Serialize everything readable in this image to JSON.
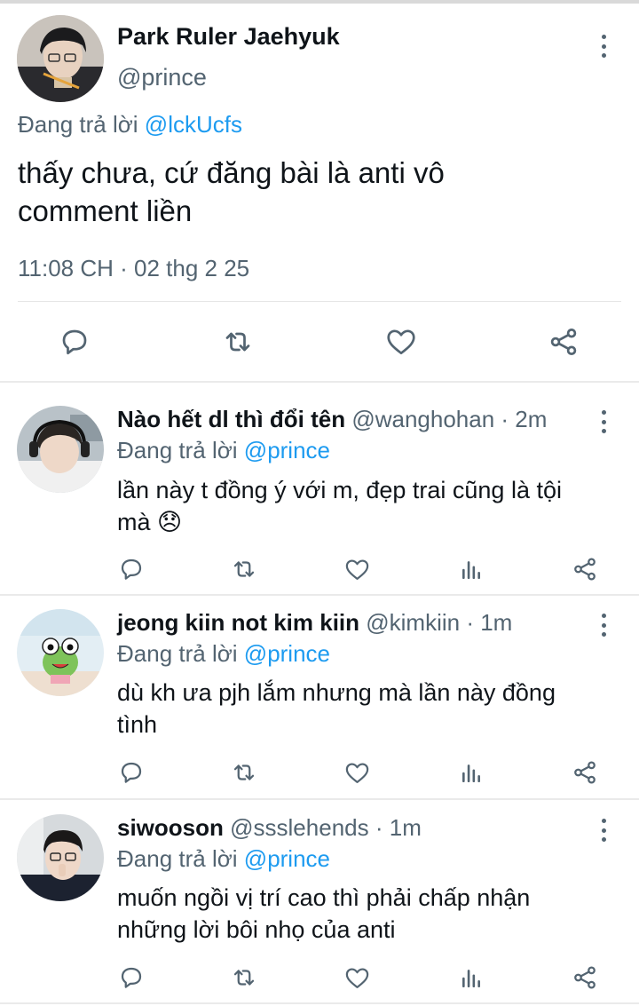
{
  "main_tweet": {
    "author_name": "Park Ruler Jaehyuk",
    "handle": "@prince",
    "reply_prefix": "Đang trả lời",
    "reply_to": "@lckUcfs",
    "text_line1": "thấy chưa, cứ đăng bài là anti vô",
    "text_line2": "comment liền",
    "timestamp": "11:08 CH · 02 thg 2 25"
  },
  "replies": [
    {
      "author_name": "Nào hết dl thì đổi tên",
      "handle": "@wanghohan",
      "time": "· 2m",
      "reply_prefix": "Đang trả lời",
      "reply_to": "@prince",
      "text_line1": "lần này t đồng ý với m, đẹp trai cũng là tội",
      "text_line2": "mà 😞"
    },
    {
      "author_name": "jeong kiin not kim kiin",
      "handle": "@kimkiin",
      "time": "· 1m",
      "reply_prefix": "Đang trả lời",
      "reply_to": "@prince",
      "text_line1": "dù kh ưa pjh lắm nhưng mà lần này đồng",
      "text_line2": "tình"
    },
    {
      "author_name": "siwooson",
      "handle": "@ssslehends",
      "time": "· 1m",
      "reply_prefix": "Đang trả lời",
      "reply_to": "@prince",
      "text_line1": "muốn ngồi vị trí cao thì phải chấp nhận",
      "text_line2": "những lời bôi nhọ của anti"
    }
  ],
  "icons": {
    "reply": "reply-icon",
    "retweet": "retweet-icon",
    "like": "like-icon",
    "views": "views-icon",
    "share": "share-icon",
    "more": "more-icon"
  },
  "colors": {
    "text": "#0f1419",
    "secondary": "#536471",
    "accent": "#1d9bf0",
    "divider": "#eaeaea"
  }
}
